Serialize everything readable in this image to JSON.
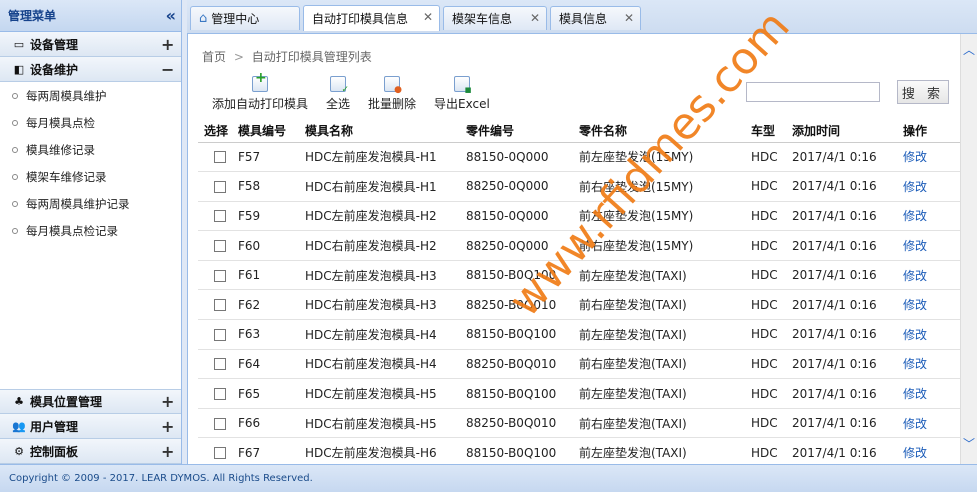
{
  "sidebar": {
    "title": "管理菜单",
    "collapse_icon": "double-chevron-left-icon",
    "sections": [
      {
        "label": "设备管理",
        "toggle": "+",
        "icon": "monitor-icon"
      },
      {
        "label": "设备维护",
        "toggle": "−",
        "icon": "wrench-icon"
      }
    ],
    "items": [
      {
        "label": "每两周模具维护"
      },
      {
        "label": "每月模具点检"
      },
      {
        "label": "模具维修记录"
      },
      {
        "label": "模架车维修记录"
      },
      {
        "label": "每两周模具维护记录"
      },
      {
        "label": "每月模具点检记录"
      }
    ],
    "bottom_sections": [
      {
        "label": "模具位置管理",
        "toggle": "+",
        "icon": "leaf-icon"
      },
      {
        "label": "用户管理",
        "toggle": "+",
        "icon": "users-icon"
      },
      {
        "label": "控制面板",
        "toggle": "+",
        "icon": "gear-icon"
      }
    ]
  },
  "tabs": [
    {
      "label": "管理中心",
      "closable": false,
      "active": false
    },
    {
      "label": "自动打印模具信息",
      "closable": true,
      "active": true
    },
    {
      "label": "模架车信息",
      "closable": true,
      "active": false
    },
    {
      "label": "模具信息",
      "closable": true,
      "active": false
    }
  ],
  "breadcrumb": {
    "home": "首页",
    "separator": ">",
    "current": "自动打印模具管理列表"
  },
  "toolbar": {
    "add_label": "添加自动打印模具",
    "select_all_label": "全选",
    "batch_delete_label": "批量删除",
    "export_label": "导出Excel",
    "search_value": "",
    "search_button": "搜 索"
  },
  "table": {
    "headers": [
      "选择",
      "模具编号",
      "模具名称",
      "零件编号",
      "零件名称",
      "车型",
      "添加时间",
      "操作"
    ],
    "edit_label": "修改",
    "rows": [
      [
        "F57",
        "HDC左前座发泡模具-H1",
        "88150-0Q000",
        "前左座垫发泡(15MY)",
        "HDC",
        "2017/4/1 0:16"
      ],
      [
        "F58",
        "HDC右前座发泡模具-H1",
        "88250-0Q000",
        "前右座垫发泡(15MY)",
        "HDC",
        "2017/4/1 0:16"
      ],
      [
        "F59",
        "HDC左前座发泡模具-H2",
        "88150-0Q000",
        "前左座垫发泡(15MY)",
        "HDC",
        "2017/4/1 0:16"
      ],
      [
        "F60",
        "HDC右前座发泡模具-H2",
        "88250-0Q000",
        "前右座垫发泡(15MY)",
        "HDC",
        "2017/4/1 0:16"
      ],
      [
        "F61",
        "HDC左前座发泡模具-H3",
        "88150-B0Q100",
        "前左座垫发泡(TAXI)",
        "HDC",
        "2017/4/1 0:16"
      ],
      [
        "F62",
        "HDC右前座发泡模具-H3",
        "88250-B0Q010",
        "前右座垫发泡(TAXI)",
        "HDC",
        "2017/4/1 0:16"
      ],
      [
        "F63",
        "HDC左前座发泡模具-H4",
        "88150-B0Q100",
        "前左座垫发泡(TAXI)",
        "HDC",
        "2017/4/1 0:16"
      ],
      [
        "F64",
        "HDC右前座发泡模具-H4",
        "88250-B0Q010",
        "前右座垫发泡(TAXI)",
        "HDC",
        "2017/4/1 0:16"
      ],
      [
        "F65",
        "HDC左前座发泡模具-H5",
        "88150-B0Q100",
        "前左座垫发泡(TAXI)",
        "HDC",
        "2017/4/1 0:16"
      ],
      [
        "F66",
        "HDC右前座发泡模具-H5",
        "88250-B0Q010",
        "前右座垫发泡(TAXI)",
        "HDC",
        "2017/4/1 0:16"
      ],
      [
        "F67",
        "HDC左前座发泡模具-H6",
        "88150-B0Q100",
        "前左座垫发泡(TAXI)",
        "HDC",
        "2017/4/1 0:16"
      ]
    ]
  },
  "watermark": "www.rfidmes.com",
  "footer": {
    "copyright": "Copyright © 2009 - 2017. LEAR DYMOS. All Rights Reserved."
  },
  "colors": {
    "accent": "#99bbe8",
    "link": "#1a5bb8",
    "watermark": "#f07c16"
  }
}
